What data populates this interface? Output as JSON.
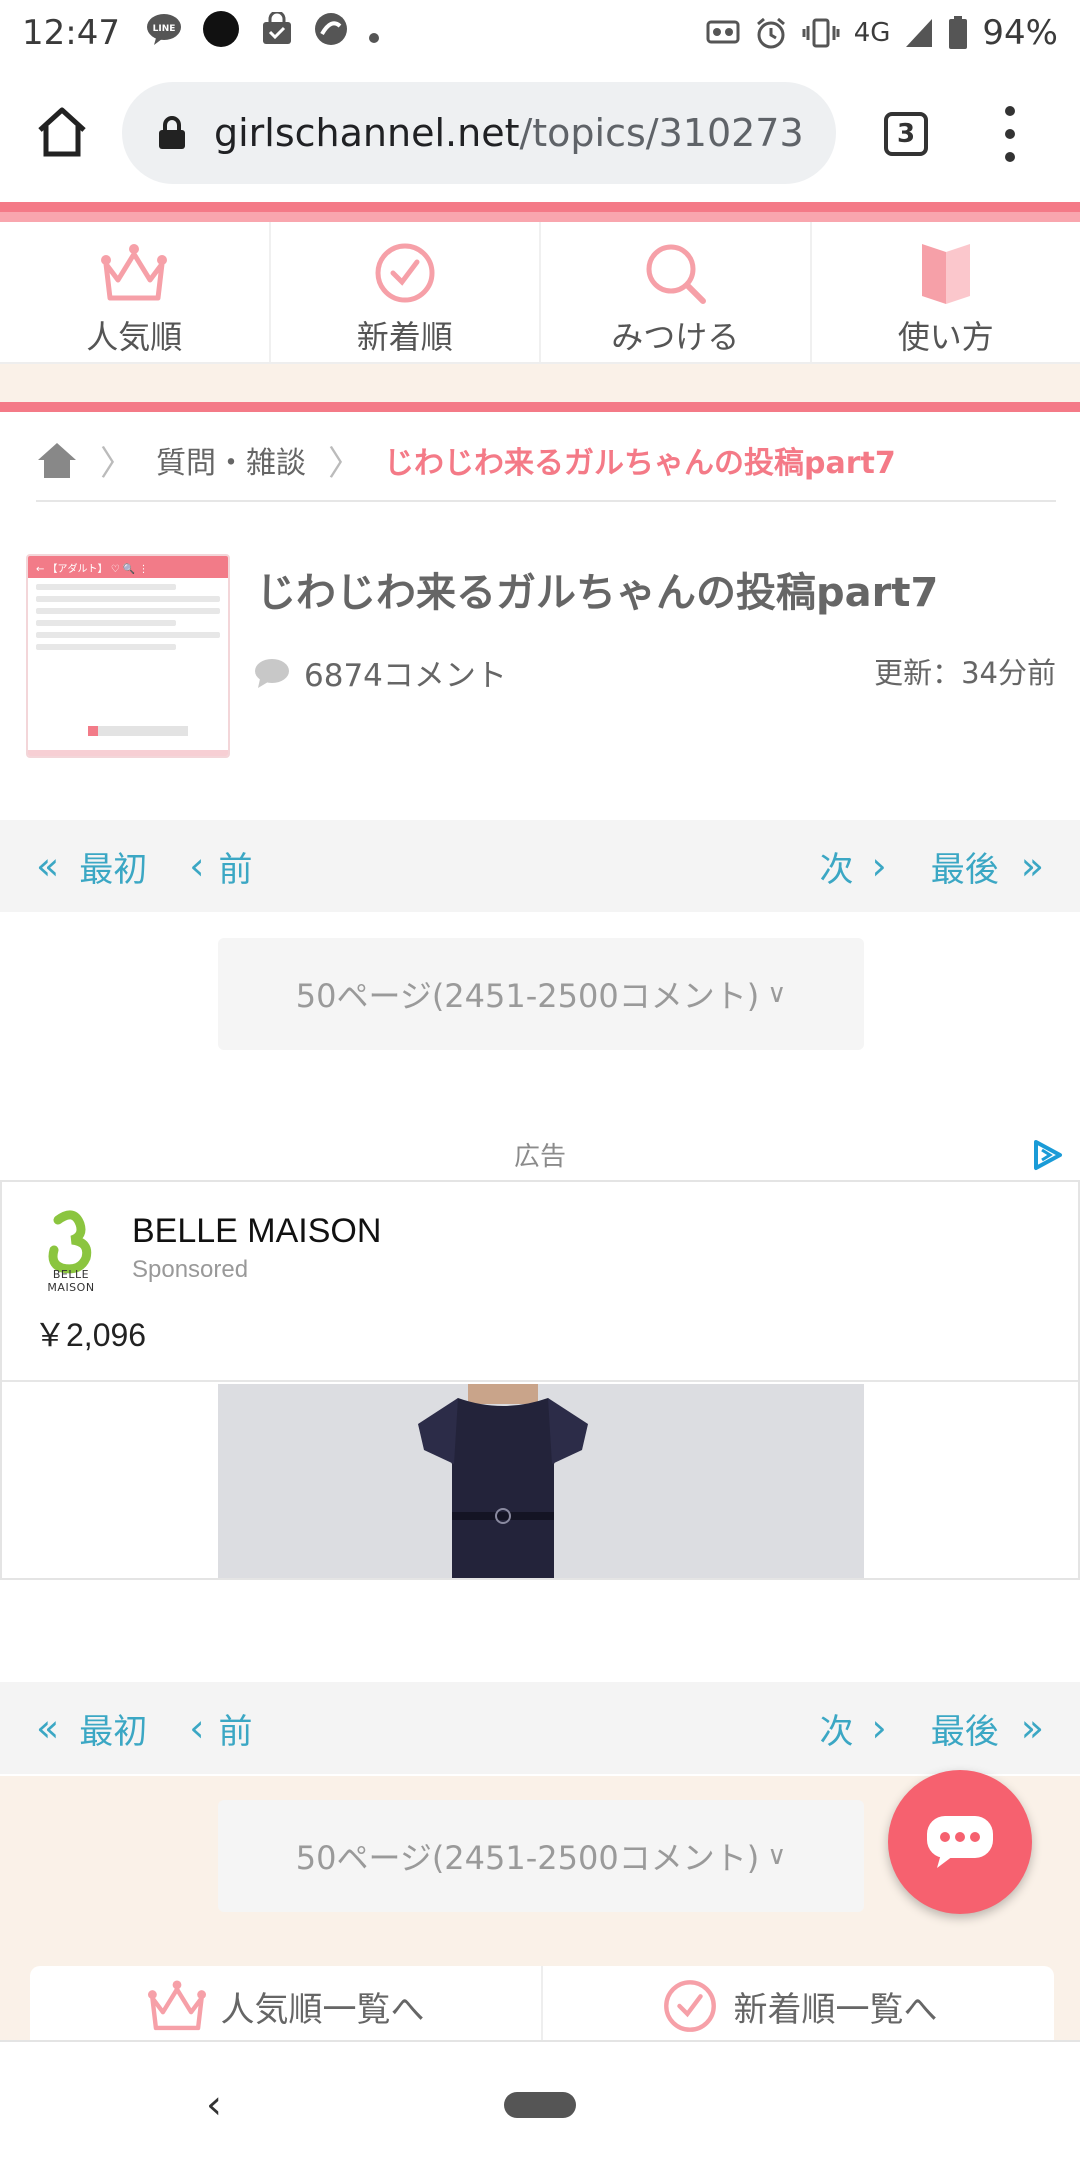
{
  "status_bar": {
    "time": "12:47",
    "network": "4G",
    "battery": "94%",
    "icons": [
      "line-icon",
      "dot-icon",
      "shopping-icon",
      "app-icon",
      "more-dot-icon",
      "cast-icon",
      "alarm-icon",
      "vibrate-icon",
      "signal-icon",
      "battery-icon"
    ]
  },
  "browser": {
    "url_domain": "girlschannel.net",
    "url_path": "/topics/310273",
    "tab_count": "3"
  },
  "site_nav": {
    "items": [
      {
        "label": "人気順",
        "icon": "crown-icon"
      },
      {
        "label": "新着順",
        "icon": "clock-icon"
      },
      {
        "label": "みつける",
        "icon": "search-icon"
      },
      {
        "label": "使い方",
        "icon": "book-icon"
      }
    ]
  },
  "breadcrumb": {
    "category": "質問・雑談",
    "current": "じわじわ来るガルちゃんの投稿part7"
  },
  "topic": {
    "title": "じわじわ来るガルちゃんの投稿part7",
    "comment_count": "6874コメント",
    "updated": "更新：34分前"
  },
  "pager": {
    "first": "最初",
    "prev": "前",
    "next": "次",
    "last": "最後"
  },
  "page_select": {
    "value": "50ページ(2451-2500コメント)"
  },
  "ad": {
    "label": "広告",
    "brand": "BELLE MAISON",
    "logo_text": "BELLE MAISON",
    "sponsored": "Sponsored",
    "price": "￥2,096"
  },
  "footer_nav": {
    "popular": "人気順一覧へ",
    "newest": "新着順一覧へ"
  },
  "colors": {
    "brand_pink": "#f47a87",
    "link_blue": "#3ba7c4",
    "cream": "#faf1e8",
    "fab": "#f6616f"
  }
}
